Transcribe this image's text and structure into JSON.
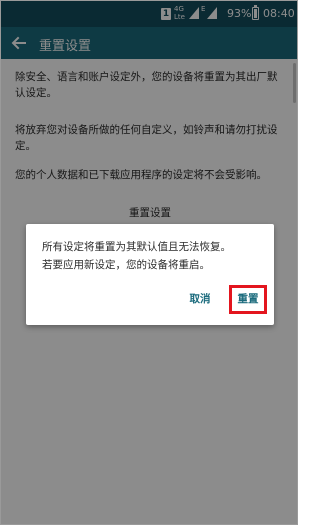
{
  "status_bar": {
    "notification": "1",
    "network_type": "4G",
    "network_sub": "Lte",
    "second_sim": "E",
    "battery_percent": "93%",
    "time": "08:40"
  },
  "app_bar": {
    "back_icon": "back-arrow-icon",
    "title": "重置设置"
  },
  "content": {
    "paragraph_1": "除安全、语言和账户设定外，您的设备将重置为其出厂默认设定。",
    "paragraph_2": "将放弃您对设备所做的任何自定义，如铃声和请勿打扰设定。",
    "paragraph_3": "您的个人数据和已下载应用程序的设定将不会受影响。",
    "reset_button_label": "重置设置"
  },
  "dialog": {
    "message_line_1": "所有设定将重置为其默认值且无法恢复。",
    "message_line_2": "若要应用新设定，您的设备将重启。",
    "cancel_label": "取消",
    "confirm_label": "重置",
    "highlight_color": "#e3151e"
  },
  "colors": {
    "status_bar": "#134d5e",
    "app_bar": "#1b6b7d",
    "accent": "#1b6b7d"
  }
}
